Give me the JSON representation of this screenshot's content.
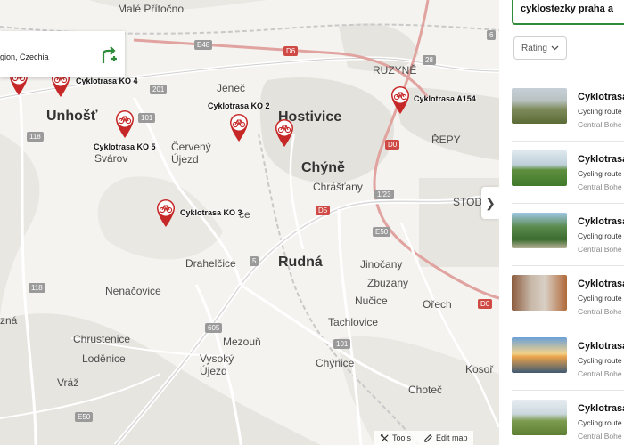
{
  "map": {
    "location_card": {
      "text": "gion, Czechia",
      "route_icon": "directions-add-icon"
    },
    "towns": [
      {
        "name": "Malé Přítočno",
        "cls": "town"
      },
      {
        "name": "RUZYNĚ",
        "cls": "town"
      },
      {
        "name": "Unhošť",
        "cls": "town big"
      },
      {
        "name": "Jeneč",
        "cls": "town"
      },
      {
        "name": "Hostivice",
        "cls": "town big"
      },
      {
        "name": "Červený Újezd",
        "cls": "town"
      },
      {
        "name": "Svárov",
        "cls": "town"
      },
      {
        "name": "Chýně",
        "cls": "town big"
      },
      {
        "name": "Chrášťany",
        "cls": "town"
      },
      {
        "name": "ŘEPY",
        "cls": "town"
      },
      {
        "name": "STODŮ",
        "cls": "town"
      },
      {
        "name": "Drahelčice",
        "cls": "town"
      },
      {
        "name": "Rudná",
        "cls": "town big"
      },
      {
        "name": "Jinočany",
        "cls": "town"
      },
      {
        "name": "Zbuzany",
        "cls": "town"
      },
      {
        "name": "Nenačovice",
        "cls": "town"
      },
      {
        "name": "Nučice",
        "cls": "town"
      },
      {
        "name": "Ořech",
        "cls": "town"
      },
      {
        "name": "Tachlovice",
        "cls": "town"
      },
      {
        "name": "Chrustenice",
        "cls": "town"
      },
      {
        "name": "Loděnice",
        "cls": "town"
      },
      {
        "name": "Mezouň",
        "cls": "town"
      },
      {
        "name": "Vysoký Újezd",
        "cls": "town"
      },
      {
        "name": "Chýnice",
        "cls": "town"
      },
      {
        "name": "Vráž",
        "cls": "town"
      },
      {
        "name": "Choteč",
        "cls": "town"
      },
      {
        "name": "Kosoř",
        "cls": "town"
      },
      {
        "name": "zná",
        "cls": "town"
      },
      {
        "name": "ce",
        "cls": "town"
      }
    ],
    "shields": [
      {
        "label": "E48",
        "cls": "gray"
      },
      {
        "label": "D6",
        "cls": "red"
      },
      {
        "label": "201",
        "cls": "gray"
      },
      {
        "label": "101",
        "cls": "gray"
      },
      {
        "label": "118",
        "cls": "gray"
      },
      {
        "label": "D0",
        "cls": "red"
      },
      {
        "label": "D5",
        "cls": "red"
      },
      {
        "label": "E50",
        "cls": "gray"
      },
      {
        "label": "1/23",
        "cls": "gray"
      },
      {
        "label": "D0",
        "cls": "red"
      },
      {
        "label": "118",
        "cls": "gray"
      },
      {
        "label": "605",
        "cls": "gray"
      },
      {
        "label": "101",
        "cls": "gray"
      },
      {
        "label": "E50",
        "cls": "gray"
      },
      {
        "label": "28",
        "cls": "gray"
      },
      {
        "label": "6",
        "cls": "gray"
      },
      {
        "label": "5",
        "cls": "gray"
      }
    ],
    "pins": [
      {
        "label": "",
        "icon": "bicycle-pin-icon"
      },
      {
        "label": "Cyklotrasa KO 4",
        "icon": "bicycle-pin-icon"
      },
      {
        "label": "Cyklotrasa KO 5",
        "icon": "bicycle-pin-icon"
      },
      {
        "label": "Cyklotrasa KO 2",
        "icon": "bicycle-pin-icon"
      },
      {
        "label": "",
        "icon": "bicycle-pin-icon"
      },
      {
        "label": "Cyklotrasa A154",
        "icon": "bicycle-pin-icon"
      },
      {
        "label": "Cyklotrasa KO 3",
        "icon": "bicycle-pin-icon"
      }
    ],
    "bottom_bar": {
      "tools": "Tools",
      "edit_map": "Edit map"
    },
    "collapse_icon": "chevron-right-icon"
  },
  "panel": {
    "search_value": "cyklostezky praha a",
    "rating_filter": "Rating",
    "results": [
      {
        "title": "Cyklotrasa",
        "subtitle": "Cycling route",
        "location": "Central Bohe",
        "thumb": "stone-monument"
      },
      {
        "title": "Cyklotrasa",
        "subtitle": "Cycling route",
        "location": "Central Bohe",
        "thumb": "green-field"
      },
      {
        "title": "Cyklotrasa",
        "subtitle": "Cycling route",
        "location": "Central Bohe",
        "thumb": "forest-path"
      },
      {
        "title": "Cyklotrasa",
        "subtitle": "Cycling route",
        "location": "Central Bohe",
        "thumb": "autumn-trees"
      },
      {
        "title": "Cyklotrasa",
        "subtitle": "Cycling route",
        "location": "Central Bohe",
        "thumb": "sunset-lake"
      },
      {
        "title": "Cyklotrasa",
        "subtitle": "Cycling route",
        "location": "Central Bohe",
        "thumb": "meadow"
      }
    ]
  },
  "colors": {
    "accent": "#2e8b3a",
    "pin": "#c62828",
    "motorway": "#d04a45"
  }
}
